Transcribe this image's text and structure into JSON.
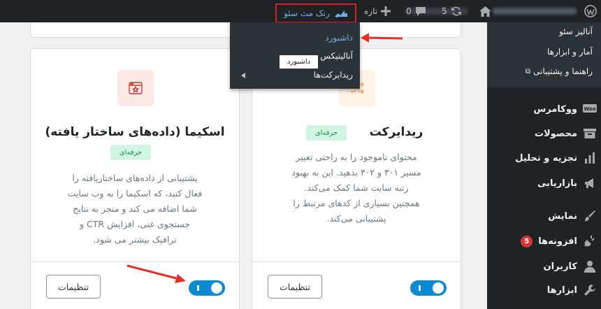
{
  "adminbar": {
    "new_label": "تازه",
    "comments_count": "0",
    "updates_count": "5",
    "rank_math_label": "رنک مث سئو",
    "colors": {
      "bg": "#1d2327",
      "highlight_border": "#e01b24",
      "link": "#72aee6"
    }
  },
  "dropdown": {
    "items": [
      {
        "label": "داشبورد",
        "active": true
      },
      {
        "label": "آنالیتیکس",
        "active": false
      },
      {
        "label": "ریدایرکت‌ها",
        "active": false,
        "has_submenu": true
      }
    ],
    "tooltip": "داشبورد"
  },
  "sidebar": {
    "submenu": [
      "آنالیز سئو",
      "آمار و ابزارها",
      "راهنما و پشتیبانی"
    ],
    "menu": [
      {
        "label": "ووکامرس",
        "icon": "woo-icon"
      },
      {
        "label": "محصولات",
        "icon": "archive-icon"
      },
      {
        "label": "تجزیه و تحلیل",
        "icon": "bar-chart-icon"
      },
      {
        "label": "بازاریابی",
        "icon": "megaphone-icon"
      },
      {
        "label": "نمایش",
        "icon": "brush-icon"
      },
      {
        "label": "افزونه‌ها",
        "icon": "plugin-icon",
        "badge": "5"
      },
      {
        "label": "کاربران",
        "icon": "user-icon"
      },
      {
        "label": "ابزارها",
        "icon": "wrench-icon"
      }
    ]
  },
  "cards": {
    "redirect": {
      "title": "ریدایرکت",
      "badge": "حرفه‌ای",
      "description_lines": [
        "محتوای ناموجود را به راحتی تغییر",
        "مسیر ۳۰۱ و ۳۰۲ بدهید. این به بهبود",
        "رتبه سایت شما کمک می‌کند.",
        "همچنین بسیاری از کدهای مرتبط را",
        "پشتیبانی می‌کند."
      ],
      "settings_label": "تنظیمات",
      "enabled": true
    },
    "schema": {
      "title": "اسکیما (داده‌های ساختار یافته)",
      "badge": "حرفه‌ای",
      "description_lines": [
        "پشتیبانی از داده‌های ساختاریافته را",
        "فعال کنید، که اسکیما را به وب سایت",
        "شما اضافه می کند و منجر به نتایج",
        "جستجوی غنی، افزایش CTR و",
        "ترافیک بیشتر می شود."
      ],
      "settings_label": "تنظیمات",
      "enabled": true
    }
  },
  "colors": {
    "toggle_on": "#0a8ad2",
    "badge_bg": "#d1f5e3",
    "badge_text": "#1a8a50",
    "arrow": "#e5302a"
  }
}
